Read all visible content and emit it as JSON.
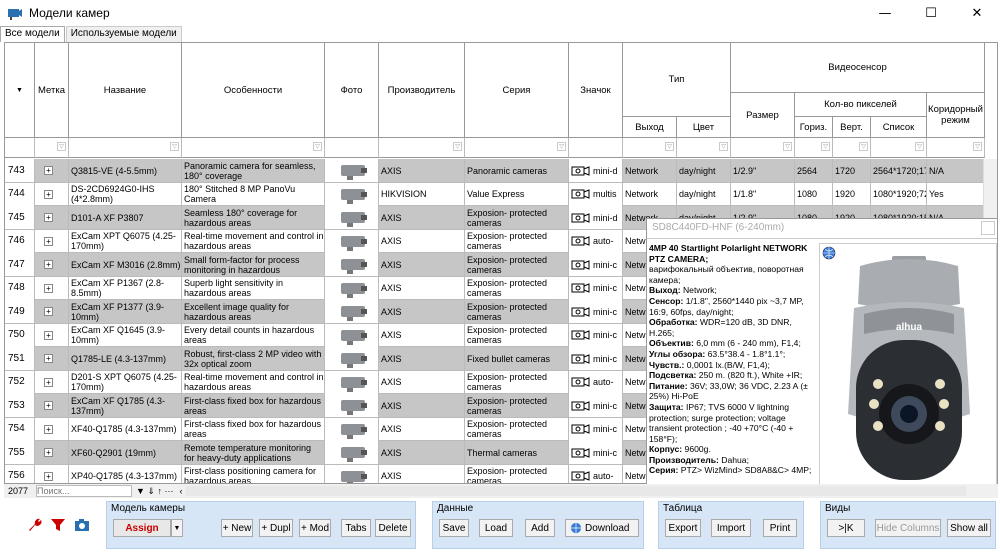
{
  "window": {
    "title": "Модели камер",
    "minimize": "—",
    "maximize": "☐",
    "close": "✕"
  },
  "tabs": [
    "Все модели",
    "Используемые модели"
  ],
  "columns": {
    "mark": "Метка",
    "name": "Название",
    "features": "Особенности",
    "photo": "Фото",
    "maker": "Производитель",
    "series": "Серия",
    "icon": "Значок",
    "type": "Тип",
    "output": "Выход",
    "color": "Цвет",
    "sensor": "Видеосенсор",
    "size": "Размер",
    "pixels": "Кол-во пикселей",
    "horiz": "Гориз.",
    "vert": "Верт.",
    "list": "Список",
    "corridor": "Коридорный режим"
  },
  "rows": [
    {
      "num": "743",
      "name": "Q3815-VE (4-5.5mm)",
      "features": "Panoramic camera for seamless, 180° coverage",
      "maker": "AXIS",
      "series": "Panoramic cameras",
      "icon": "mini-d",
      "output": "Network",
      "color": "day/night",
      "size": "1/2.9\"",
      "h": "2564",
      "v": "1720",
      "list": "2564*1720;17",
      "cor": "N/A"
    },
    {
      "num": "744",
      "name": "DS-2CD6924G0-IHS (4*2.8mm)",
      "features": "180° Stitched 8 MP PanoVu Camera",
      "maker": "HIKVISION",
      "series": "Value Express",
      "icon": "multis",
      "output": "Network",
      "color": "day/night",
      "size": "1/1.8\"",
      "h": "1080",
      "v": "1920",
      "list": "1080*1920;72",
      "cor": "Yes"
    },
    {
      "num": "745",
      "name": "D101-A XF P3807",
      "features": "Seamless 180° coverage for hazardous areas",
      "maker": "AXIS",
      "series": "Exposion- protected cameras",
      "icon": "mini-d",
      "output": "Network",
      "color": "day/night",
      "size": "1/2.9\"",
      "h": "1080",
      "v": "1920",
      "list": "1080*1920;15",
      "cor": "N/A"
    },
    {
      "num": "746",
      "name": "ExCam XPT Q6075 (4.25-170mm)",
      "features": "Real-time movement and control in hazardous areas",
      "maker": "AXIS",
      "series": "Exposion- protected cameras",
      "icon": "auto-",
      "output": "Netw",
      "color": "",
      "size": "",
      "h": "",
      "v": "",
      "list": "",
      "cor": ""
    },
    {
      "num": "747",
      "name": "ExCam XF M3016 (2.8mm)",
      "features": "Small form-factor for process monitoring in hazardous",
      "maker": "AXIS",
      "series": "Exposion- protected cameras",
      "icon": "mini-c",
      "output": "Netw",
      "color": "",
      "size": "",
      "h": "",
      "v": "",
      "list": "",
      "cor": ""
    },
    {
      "num": "748",
      "name": "ExCam XF P1367 (2.8-8.5mm)",
      "features": "Superb light sensitivity in hazardous areas",
      "maker": "AXIS",
      "series": "Exposion- protected cameras",
      "icon": "mini-c",
      "output": "Netw",
      "color": "",
      "size": "",
      "h": "",
      "v": "",
      "list": "",
      "cor": ""
    },
    {
      "num": "749",
      "name": "ExCam XF P1377 (3.9-10mm)",
      "features": "Excellent image quality for hazardous areas",
      "maker": "AXIS",
      "series": "Exposion- protected cameras",
      "icon": "mini-c",
      "output": "Netw",
      "color": "",
      "size": "",
      "h": "",
      "v": "",
      "list": "",
      "cor": ""
    },
    {
      "num": "750",
      "name": "ExCam XF Q1645 (3.9-10mm)",
      "features": "Every detail counts in hazardous areas",
      "maker": "AXIS",
      "series": "Exposion- protected cameras",
      "icon": "mini-c",
      "output": "Netw",
      "color": "",
      "size": "",
      "h": "",
      "v": "",
      "list": "",
      "cor": ""
    },
    {
      "num": "751",
      "name": "Q1785-LE (4.3-137mm)",
      "features": "Robust, first-class 2 MP video with 32x optical zoom",
      "maker": "AXIS",
      "series": "Fixed bullet cameras",
      "icon": "mini-c",
      "output": "Netw",
      "color": "",
      "size": "",
      "h": "",
      "v": "",
      "list": "",
      "cor": ""
    },
    {
      "num": "752",
      "name": "D201-S XPT Q6075 (4.25-170mm)",
      "features": "Real-time movement and control in hazardous areas",
      "maker": "AXIS",
      "series": "Exposion- protected cameras",
      "icon": "auto-",
      "output": "Netw",
      "color": "",
      "size": "",
      "h": "",
      "v": "",
      "list": "",
      "cor": ""
    },
    {
      "num": "753",
      "name": "ExCam XF Q1785 (4.3-137mm)",
      "features": "First-class fixed box for hazardous areas",
      "maker": "AXIS",
      "series": "Exposion- protected cameras",
      "icon": "mini-c",
      "output": "Netw",
      "color": "",
      "size": "",
      "h": "",
      "v": "",
      "list": "",
      "cor": ""
    },
    {
      "num": "754",
      "name": "XF40-Q1785 (4.3-137mm)",
      "features": "First-class fixed box for hazardous areas",
      "maker": "AXIS",
      "series": "Exposion- protected cameras",
      "icon": "mini-c",
      "output": "Netw",
      "color": "",
      "size": "",
      "h": "",
      "v": "",
      "list": "",
      "cor": ""
    },
    {
      "num": "755",
      "name": "XF60-Q2901 (19mm)",
      "features": "Remote temperature monitoring for heavy-duty applications",
      "maker": "AXIS",
      "series": "Thermal cameras",
      "icon": "mini-c",
      "output": "Netw",
      "color": "",
      "size": "",
      "h": "",
      "v": "",
      "list": "",
      "cor": ""
    },
    {
      "num": "756",
      "name": "XP40-Q1785 (4.3-137mm)",
      "features": "First-class positioning camera for hazardous areas",
      "maker": "AXIS",
      "series": "Exposion- protected cameras",
      "icon": "auto-",
      "output": "Netw",
      "color": "",
      "size": "",
      "h": "",
      "v": "",
      "list": "",
      "cor": ""
    }
  ],
  "status": {
    "count": "2077",
    "search_placeholder": "Поиск..."
  },
  "popup": {
    "header": "SD8C440FD-HNF (6-240mm)",
    "title": "4MP 40 Startlight Polarlight NETWORK PTZ CAMERA;",
    "desc": "варифокальный объектив, поворотная камера;",
    "lines": [
      {
        "k": "Выход:",
        "v": " Network;"
      },
      {
        "k": "Сенсор:",
        "v": " 1/1.8\", 2560*1440 pix ~3,7 MP, 16:9, 60fps, day/night;"
      },
      {
        "k": "Обработка:",
        "v": " WDR=120 dB, 3D DNR, H.265;"
      },
      {
        "k": "Объектив:",
        "v": " 6,0 mm (6 - 240 mm), F1,4;"
      },
      {
        "k": "Углы обзора:",
        "v": " 63.5°38.4 - 1.8°1.1°;"
      },
      {
        "k": "Чувств.:",
        "v": " 0,0001 lx.(B/W, F1,4);"
      },
      {
        "k": "Подсветка:",
        "v": " 250 m. (820 ft.), White +IR;"
      },
      {
        "k": "Питание:",
        "v": " 36V; 33,0W; 36 VDC, 2.23 A (± 25%) Hi-PoE"
      },
      {
        "k": "Защита:",
        "v": " IP67; TVS 6000 V lightning protection; surge protection; voltage transient protection ; -40 +70°C (-40 + 158°F);"
      },
      {
        "k": "Корпус:",
        "v": " 9600g."
      },
      {
        "k": "Производитель:",
        "v": " Dahua;"
      },
      {
        "k": "Серия:",
        "v": " PTZ> WizMind> SD8A8&C> 4MP;"
      }
    ],
    "brand": "alhua"
  },
  "toolbar": {
    "models_label": "Модель камеры",
    "assign": "Assign",
    "new": "+ New",
    "dupl": "+ Dupl",
    "mod": "+ Mod",
    "tabs": "Tabs",
    "delete": "Delete",
    "data_label": "Данные",
    "save": "Save",
    "load": "Load",
    "add": "Add",
    "download": "Download",
    "table_label": "Таблица",
    "export": "Export",
    "import": "Import",
    "print": "Print",
    "views_label": "Виды",
    "first": ">|K",
    "hide_columns": "Hide Columns",
    "show_all": "Show all"
  },
  "colors": {
    "row_alt": "#c6c6c6",
    "toolbar_group": "#d6e6f7",
    "assign_text": "#cc0000"
  }
}
